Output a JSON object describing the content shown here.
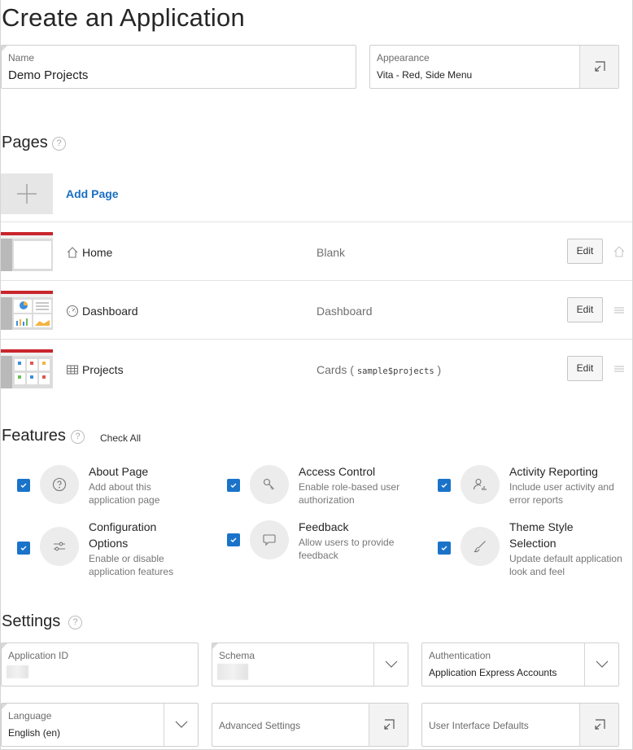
{
  "page": {
    "title": "Create an Application"
  },
  "name_field": {
    "label": "Name",
    "value": "Demo Projects"
  },
  "appearance_field": {
    "label": "Appearance",
    "value": "Vita - Red, Side Menu"
  },
  "pages_section": {
    "title": "Pages",
    "add_label": "Add Page",
    "rows": [
      {
        "name": "Home",
        "type": "Blank",
        "source": "",
        "edit": "Edit",
        "icon": "home-icon"
      },
      {
        "name": "Dashboard",
        "type": "Dashboard",
        "source": "",
        "edit": "Edit",
        "icon": "dashboard-icon"
      },
      {
        "name": "Projects",
        "type": "Cards",
        "source": "sample$projects",
        "edit": "Edit",
        "icon": "grid-icon"
      }
    ]
  },
  "features_section": {
    "title": "Features",
    "check_all": "Check All",
    "items": [
      {
        "title": "About Page",
        "desc": "Add about this application page",
        "checked": true,
        "icon": "help-icon"
      },
      {
        "title": "Access Control",
        "desc": "Enable role-based user authorization",
        "checked": true,
        "icon": "key-icon"
      },
      {
        "title": "Activity Reporting",
        "desc": "Include user activity and error reports",
        "checked": true,
        "icon": "user-chart-icon"
      },
      {
        "title": "Configuration Options",
        "desc": "Enable or disable application features",
        "checked": true,
        "icon": "sliders-icon"
      },
      {
        "title": "Feedback",
        "desc": "Allow users to provide feedback",
        "checked": true,
        "icon": "comment-icon"
      },
      {
        "title": "Theme Style Selection",
        "desc": "Update default application look and feel",
        "checked": true,
        "icon": "brush-icon"
      }
    ]
  },
  "settings_section": {
    "title": "Settings",
    "application_id": {
      "label": "Application ID"
    },
    "schema": {
      "label": "Schema"
    },
    "authentication": {
      "label": "Authentication",
      "value": "Application Express Accounts"
    },
    "language": {
      "label": "Language",
      "value": "English (en)"
    },
    "advanced": {
      "label": "Advanced Settings"
    },
    "ui_defaults": {
      "label": "User Interface Defaults"
    }
  },
  "colors": {
    "accent": "#1a73c9",
    "link": "#1a6ec2",
    "theme_red": "#c9252c"
  }
}
